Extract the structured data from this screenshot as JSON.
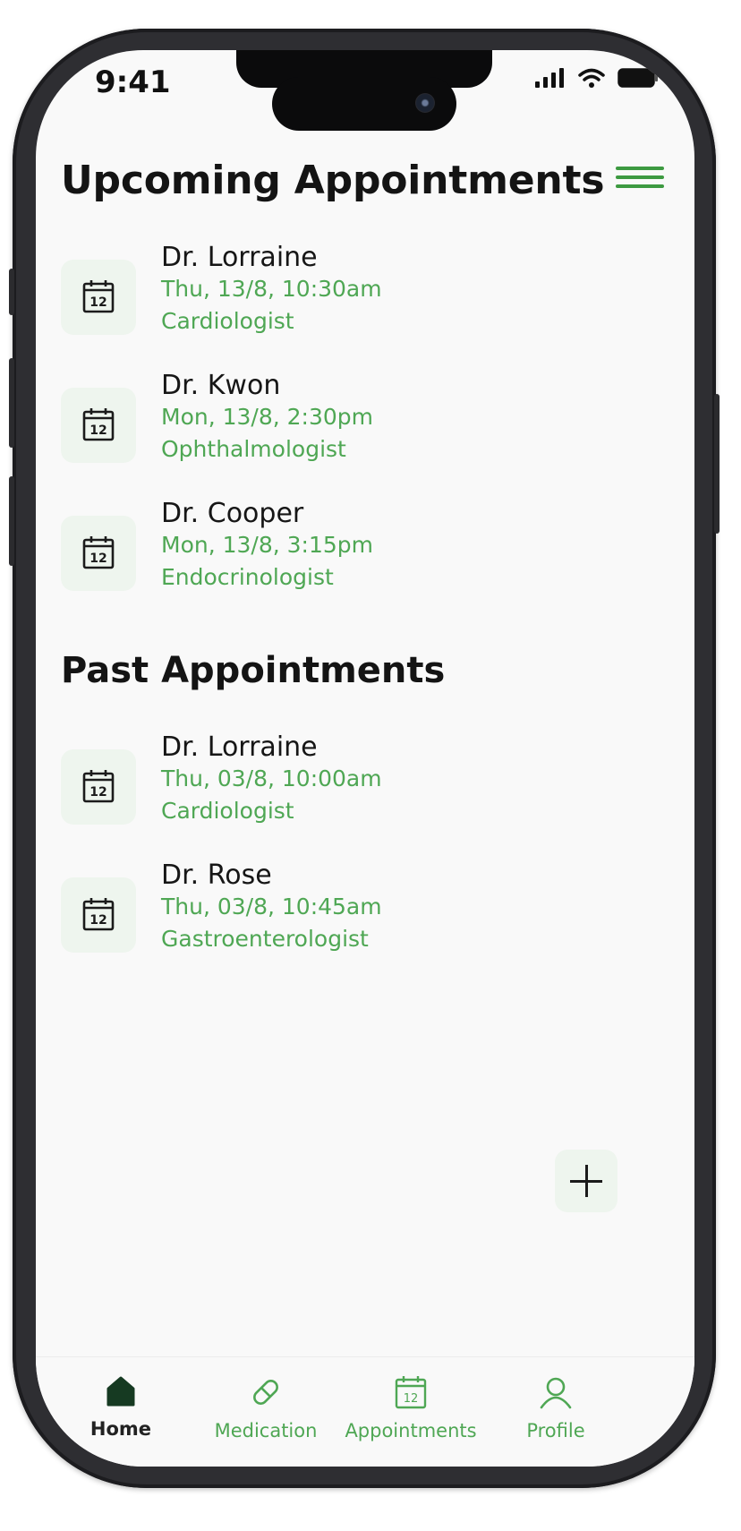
{
  "status_bar": {
    "time": "9:41"
  },
  "upcoming": {
    "title": "Upcoming Appointments",
    "items": [
      {
        "doctor": "Dr. Lorraine",
        "datetime": "Thu, 13/8, 10:30am",
        "specialty": "Cardiologist"
      },
      {
        "doctor": "Dr. Kwon",
        "datetime": "Mon, 13/8, 2:30pm",
        "specialty": "Ophthalmologist"
      },
      {
        "doctor": "Dr. Cooper",
        "datetime": "Mon, 13/8, 3:15pm",
        "specialty": "Endocrinologist"
      }
    ]
  },
  "past": {
    "title": "Past Appointments",
    "items": [
      {
        "doctor": "Dr. Lorraine",
        "datetime": "Thu, 03/8, 10:00am",
        "specialty": "Cardiologist"
      },
      {
        "doctor": "Dr. Rose",
        "datetime": "Thu, 03/8, 10:45am",
        "specialty": "Gastroenterologist"
      }
    ]
  },
  "calendar_icon_day": "12",
  "tabs": [
    {
      "label": "Home",
      "icon": "home-icon",
      "active": true
    },
    {
      "label": "Medication",
      "icon": "pill-icon",
      "active": false
    },
    {
      "label": "Appointments",
      "icon": "calendar-icon",
      "active": false
    },
    {
      "label": "Profile",
      "icon": "user-icon",
      "active": false
    }
  ],
  "colors": {
    "accent": "#4fa754",
    "accent_dark": "#3d9a41",
    "tile_bg": "#eef5ee",
    "text": "#161616"
  }
}
